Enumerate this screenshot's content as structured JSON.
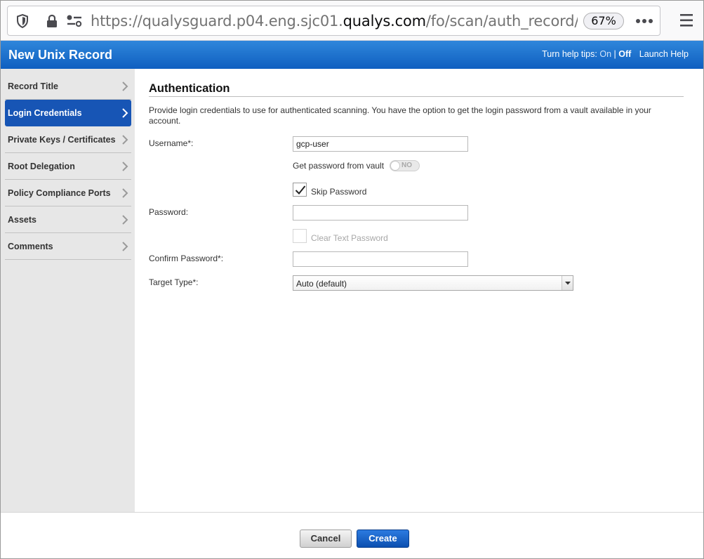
{
  "browser": {
    "url_prefix": "https://qualysguard.p04.eng.sjc01.",
    "url_host": "qualys.com",
    "url_path": "/fo/scan/auth_record/unix/?act",
    "zoom": "67%"
  },
  "header": {
    "title": "New Unix Record",
    "help_prefix": "Turn help tips:",
    "help_on": "On",
    "help_separator": "|",
    "help_off": "Off",
    "launch_help": "Launch Help",
    "color_top": "#2f86db",
    "color_bottom": "#0f5fc0"
  },
  "sidebar": {
    "items": [
      {
        "label": "Record Title",
        "active": false
      },
      {
        "label": "Login Credentials",
        "active": true
      },
      {
        "label": "Private Keys / Certificates",
        "active": false
      },
      {
        "label": "Root Delegation",
        "active": false
      },
      {
        "label": "Policy Compliance Ports",
        "active": false
      },
      {
        "label": "Assets",
        "active": false
      },
      {
        "label": "Comments",
        "active": false
      }
    ]
  },
  "form": {
    "section_title": "Authentication",
    "description": "Provide login credentials to use for authenticated scanning. You have the option to get the login password from a vault available in your account.",
    "username_label": "Username*:",
    "username_value": "gcp-user",
    "vault_label": "Get password from vault",
    "vault_toggle": "NO",
    "skip_password_label": "Skip Password",
    "skip_password_checked": true,
    "password_label": "Password:",
    "password_value": "",
    "clear_text_label": "Clear Text Password",
    "clear_text_checked": false,
    "confirm_password_label": "Confirm Password*:",
    "confirm_password_value": "",
    "target_type_label": "Target Type*:",
    "target_type_value": "Auto (default)"
  },
  "footer": {
    "cancel_label": "Cancel",
    "create_label": "Create"
  }
}
